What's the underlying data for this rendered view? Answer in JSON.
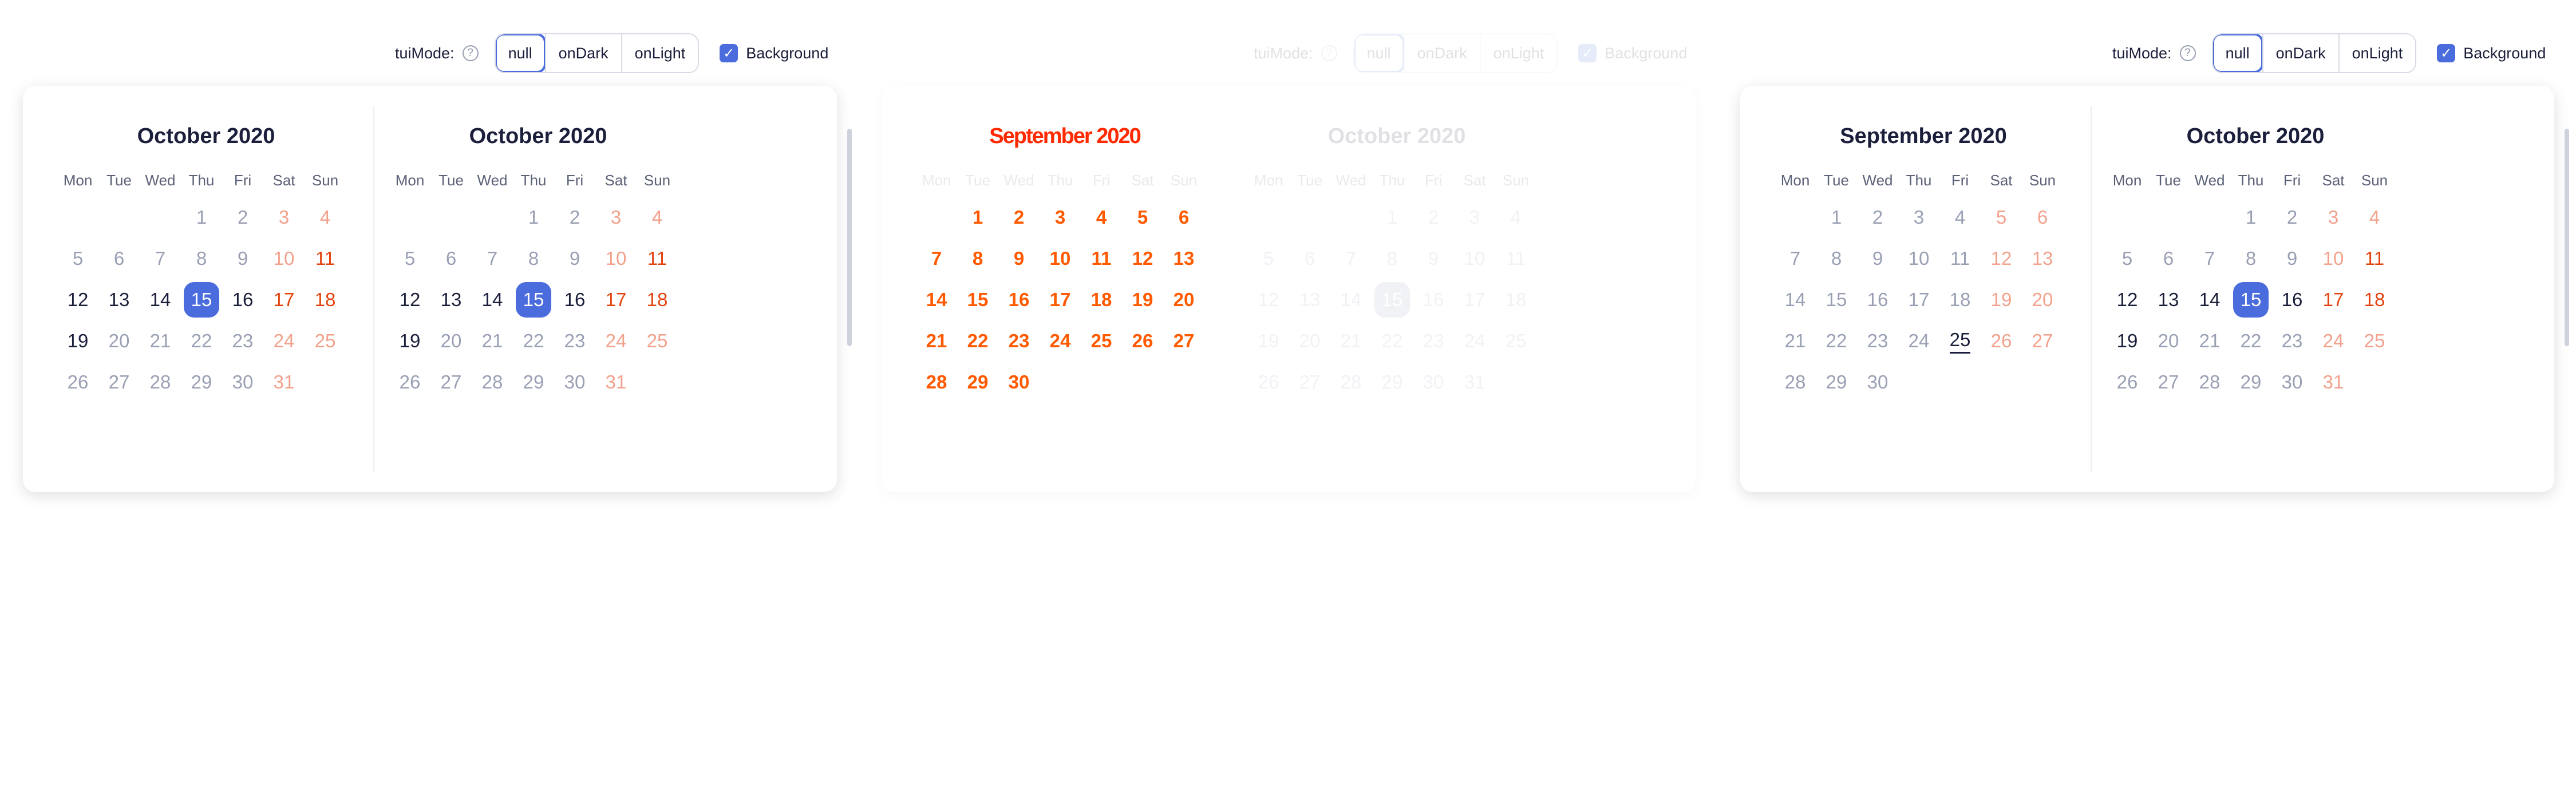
{
  "weekdays": [
    "Mon",
    "Tue",
    "Wed",
    "Thu",
    "Fri",
    "Sat",
    "Sun"
  ],
  "panels": [
    {
      "toolbar": {
        "label": "tuiMode:",
        "modes": [
          "null",
          "onDark",
          "onLight"
        ],
        "active": "null",
        "checkbox_label": "Background",
        "checked": true
      },
      "calendars": [
        {
          "title": "October 2020",
          "offset": 3,
          "days": [
            {
              "n": "1",
              "s": "dim"
            },
            {
              "n": "2",
              "s": "dim"
            },
            {
              "n": "3",
              "s": "wedim"
            },
            {
              "n": "4",
              "s": "wedim"
            },
            {
              "n": "5",
              "s": "dim"
            },
            {
              "n": "6",
              "s": "dim"
            },
            {
              "n": "7",
              "s": "dim"
            },
            {
              "n": "8",
              "s": "dim"
            },
            {
              "n": "9",
              "s": "dim"
            },
            {
              "n": "10",
              "s": "wedim"
            },
            {
              "n": "11",
              "s": "we"
            },
            {
              "n": "12",
              "s": "norm"
            },
            {
              "n": "13",
              "s": "norm"
            },
            {
              "n": "14",
              "s": "norm"
            },
            {
              "n": "15",
              "s": "sel"
            },
            {
              "n": "16",
              "s": "norm"
            },
            {
              "n": "17",
              "s": "we"
            },
            {
              "n": "18",
              "s": "we"
            },
            {
              "n": "19",
              "s": "norm"
            },
            {
              "n": "20",
              "s": "dim"
            },
            {
              "n": "21",
              "s": "dim"
            },
            {
              "n": "22",
              "s": "dim"
            },
            {
              "n": "23",
              "s": "dim"
            },
            {
              "n": "24",
              "s": "wedim"
            },
            {
              "n": "25",
              "s": "wedim"
            },
            {
              "n": "26",
              "s": "dim"
            },
            {
              "n": "27",
              "s": "dim"
            },
            {
              "n": "28",
              "s": "dim"
            },
            {
              "n": "29",
              "s": "dim"
            },
            {
              "n": "30",
              "s": "dim"
            },
            {
              "n": "31",
              "s": "wedim"
            }
          ]
        },
        {
          "title": "October 2020",
          "offset": 3,
          "days": [
            {
              "n": "1",
              "s": "dim"
            },
            {
              "n": "2",
              "s": "dim"
            },
            {
              "n": "3",
              "s": "wedim"
            },
            {
              "n": "4",
              "s": "wedim"
            },
            {
              "n": "5",
              "s": "dim"
            },
            {
              "n": "6",
              "s": "dim"
            },
            {
              "n": "7",
              "s": "dim"
            },
            {
              "n": "8",
              "s": "dim"
            },
            {
              "n": "9",
              "s": "dim"
            },
            {
              "n": "10",
              "s": "wedim"
            },
            {
              "n": "11",
              "s": "we"
            },
            {
              "n": "12",
              "s": "norm"
            },
            {
              "n": "13",
              "s": "norm"
            },
            {
              "n": "14",
              "s": "norm"
            },
            {
              "n": "15",
              "s": "sel"
            },
            {
              "n": "16",
              "s": "norm"
            },
            {
              "n": "17",
              "s": "we"
            },
            {
              "n": "18",
              "s": "we"
            },
            {
              "n": "19",
              "s": "norm"
            },
            {
              "n": "20",
              "s": "dim"
            },
            {
              "n": "21",
              "s": "dim"
            },
            {
              "n": "22",
              "s": "dim"
            },
            {
              "n": "23",
              "s": "dim"
            },
            {
              "n": "24",
              "s": "wedim"
            },
            {
              "n": "25",
              "s": "wedim"
            },
            {
              "n": "26",
              "s": "dim"
            },
            {
              "n": "27",
              "s": "dim"
            },
            {
              "n": "28",
              "s": "dim"
            },
            {
              "n": "29",
              "s": "dim"
            },
            {
              "n": "30",
              "s": "dim"
            },
            {
              "n": "31",
              "s": "wedim"
            }
          ]
        }
      ]
    },
    {
      "toolbar": {
        "label": "tuiMode:",
        "modes": [
          "null",
          "onDark",
          "onLight"
        ],
        "active": "null",
        "checkbox_label": "Background",
        "checked": true
      },
      "calendars": [
        {
          "title": "September 2020",
          "offset": 1,
          "days": [
            {
              "n": "1",
              "s": "norm"
            },
            {
              "n": "2",
              "s": "norm"
            },
            {
              "n": "3",
              "s": "norm"
            },
            {
              "n": "4",
              "s": "norm"
            },
            {
              "n": "5",
              "s": "norm"
            },
            {
              "n": "6",
              "s": "norm"
            },
            {
              "n": "7",
              "s": "norm"
            },
            {
              "n": "8",
              "s": "norm"
            },
            {
              "n": "9",
              "s": "norm"
            },
            {
              "n": "10",
              "s": "norm"
            },
            {
              "n": "11",
              "s": "norm"
            },
            {
              "n": "12",
              "s": "norm"
            },
            {
              "n": "13",
              "s": "norm"
            },
            {
              "n": "14",
              "s": "norm"
            },
            {
              "n": "15",
              "s": "norm"
            },
            {
              "n": "16",
              "s": "norm"
            },
            {
              "n": "17",
              "s": "norm"
            },
            {
              "n": "18",
              "s": "norm"
            },
            {
              "n": "19",
              "s": "norm"
            },
            {
              "n": "20",
              "s": "norm"
            },
            {
              "n": "21",
              "s": "norm"
            },
            {
              "n": "22",
              "s": "norm"
            },
            {
              "n": "23",
              "s": "norm"
            },
            {
              "n": "24",
              "s": "norm"
            },
            {
              "n": "25",
              "s": "norm"
            },
            {
              "n": "26",
              "s": "norm"
            },
            {
              "n": "27",
              "s": "norm"
            },
            {
              "n": "28",
              "s": "norm"
            },
            {
              "n": "29",
              "s": "norm"
            },
            {
              "n": "30",
              "s": "norm"
            }
          ]
        },
        {
          "title": "October 2020",
          "offset": 3,
          "days": [
            {
              "n": "1",
              "s": "dim"
            },
            {
              "n": "2",
              "s": "dim"
            },
            {
              "n": "3",
              "s": "dim"
            },
            {
              "n": "4",
              "s": "dim"
            },
            {
              "n": "5",
              "s": "dim"
            },
            {
              "n": "6",
              "s": "dim"
            },
            {
              "n": "7",
              "s": "dim"
            },
            {
              "n": "8",
              "s": "dim"
            },
            {
              "n": "9",
              "s": "dim"
            },
            {
              "n": "10",
              "s": "dim"
            },
            {
              "n": "11",
              "s": "dim"
            },
            {
              "n": "12",
              "s": "dim"
            },
            {
              "n": "13",
              "s": "dim"
            },
            {
              "n": "14",
              "s": "dim"
            },
            {
              "n": "15",
              "s": "sel"
            },
            {
              "n": "16",
              "s": "dim"
            },
            {
              "n": "17",
              "s": "dim"
            },
            {
              "n": "18",
              "s": "dim"
            },
            {
              "n": "19",
              "s": "dim"
            },
            {
              "n": "20",
              "s": "dim"
            },
            {
              "n": "21",
              "s": "dim"
            },
            {
              "n": "22",
              "s": "dim"
            },
            {
              "n": "23",
              "s": "dim"
            },
            {
              "n": "24",
              "s": "dim"
            },
            {
              "n": "25",
              "s": "dim"
            },
            {
              "n": "26",
              "s": "dim"
            },
            {
              "n": "27",
              "s": "dim"
            },
            {
              "n": "28",
              "s": "dim"
            },
            {
              "n": "29",
              "s": "dim"
            },
            {
              "n": "30",
              "s": "dim"
            },
            {
              "n": "31",
              "s": "dim"
            }
          ]
        }
      ]
    },
    {
      "toolbar": {
        "label": "tuiMode:",
        "modes": [
          "null",
          "onDark",
          "onLight"
        ],
        "active": "null",
        "checkbox_label": "Background",
        "checked": true
      },
      "calendars": [
        {
          "title": "September 2020",
          "offset": 1,
          "days": [
            {
              "n": "1",
              "s": "dim"
            },
            {
              "n": "2",
              "s": "dim"
            },
            {
              "n": "3",
              "s": "dim"
            },
            {
              "n": "4",
              "s": "dim"
            },
            {
              "n": "5",
              "s": "wedim"
            },
            {
              "n": "6",
              "s": "wedim"
            },
            {
              "n": "7",
              "s": "dim"
            },
            {
              "n": "8",
              "s": "dim"
            },
            {
              "n": "9",
              "s": "dim"
            },
            {
              "n": "10",
              "s": "dim"
            },
            {
              "n": "11",
              "s": "dim"
            },
            {
              "n": "12",
              "s": "wedim"
            },
            {
              "n": "13",
              "s": "wedim"
            },
            {
              "n": "14",
              "s": "dim"
            },
            {
              "n": "15",
              "s": "dim"
            },
            {
              "n": "16",
              "s": "dim"
            },
            {
              "n": "17",
              "s": "dim"
            },
            {
              "n": "18",
              "s": "dim"
            },
            {
              "n": "19",
              "s": "wedim"
            },
            {
              "n": "20",
              "s": "wedim"
            },
            {
              "n": "21",
              "s": "dim"
            },
            {
              "n": "22",
              "s": "dim"
            },
            {
              "n": "23",
              "s": "dim"
            },
            {
              "n": "24",
              "s": "dim"
            },
            {
              "n": "25",
              "s": "ul"
            },
            {
              "n": "26",
              "s": "wedim"
            },
            {
              "n": "27",
              "s": "wedim"
            },
            {
              "n": "28",
              "s": "dim"
            },
            {
              "n": "29",
              "s": "dim"
            },
            {
              "n": "30",
              "s": "dim"
            }
          ]
        },
        {
          "title": "October 2020",
          "offset": 3,
          "days": [
            {
              "n": "1",
              "s": "dim"
            },
            {
              "n": "2",
              "s": "dim"
            },
            {
              "n": "3",
              "s": "wedim"
            },
            {
              "n": "4",
              "s": "wedim"
            },
            {
              "n": "5",
              "s": "dim"
            },
            {
              "n": "6",
              "s": "dim"
            },
            {
              "n": "7",
              "s": "dim"
            },
            {
              "n": "8",
              "s": "dim"
            },
            {
              "n": "9",
              "s": "dim"
            },
            {
              "n": "10",
              "s": "wedim"
            },
            {
              "n": "11",
              "s": "we"
            },
            {
              "n": "12",
              "s": "norm"
            },
            {
              "n": "13",
              "s": "norm"
            },
            {
              "n": "14",
              "s": "norm"
            },
            {
              "n": "15",
              "s": "sel"
            },
            {
              "n": "16",
              "s": "norm"
            },
            {
              "n": "17",
              "s": "we"
            },
            {
              "n": "18",
              "s": "we"
            },
            {
              "n": "19",
              "s": "norm"
            },
            {
              "n": "20",
              "s": "dim"
            },
            {
              "n": "21",
              "s": "dim"
            },
            {
              "n": "22",
              "s": "dim"
            },
            {
              "n": "23",
              "s": "dim"
            },
            {
              "n": "24",
              "s": "wedim"
            },
            {
              "n": "25",
              "s": "wedim"
            },
            {
              "n": "26",
              "s": "dim"
            },
            {
              "n": "27",
              "s": "dim"
            },
            {
              "n": "28",
              "s": "dim"
            },
            {
              "n": "29",
              "s": "dim"
            },
            {
              "n": "30",
              "s": "dim"
            },
            {
              "n": "31",
              "s": "wedim"
            }
          ]
        }
      ]
    }
  ],
  "colors": {
    "accent": "#4a6cdc",
    "weekend": "#e2430f",
    "weekend_dim": "#f2a18c",
    "text": "#1b1f3b",
    "dim": "#9aa0b4",
    "glitch": "#ff1a00"
  }
}
